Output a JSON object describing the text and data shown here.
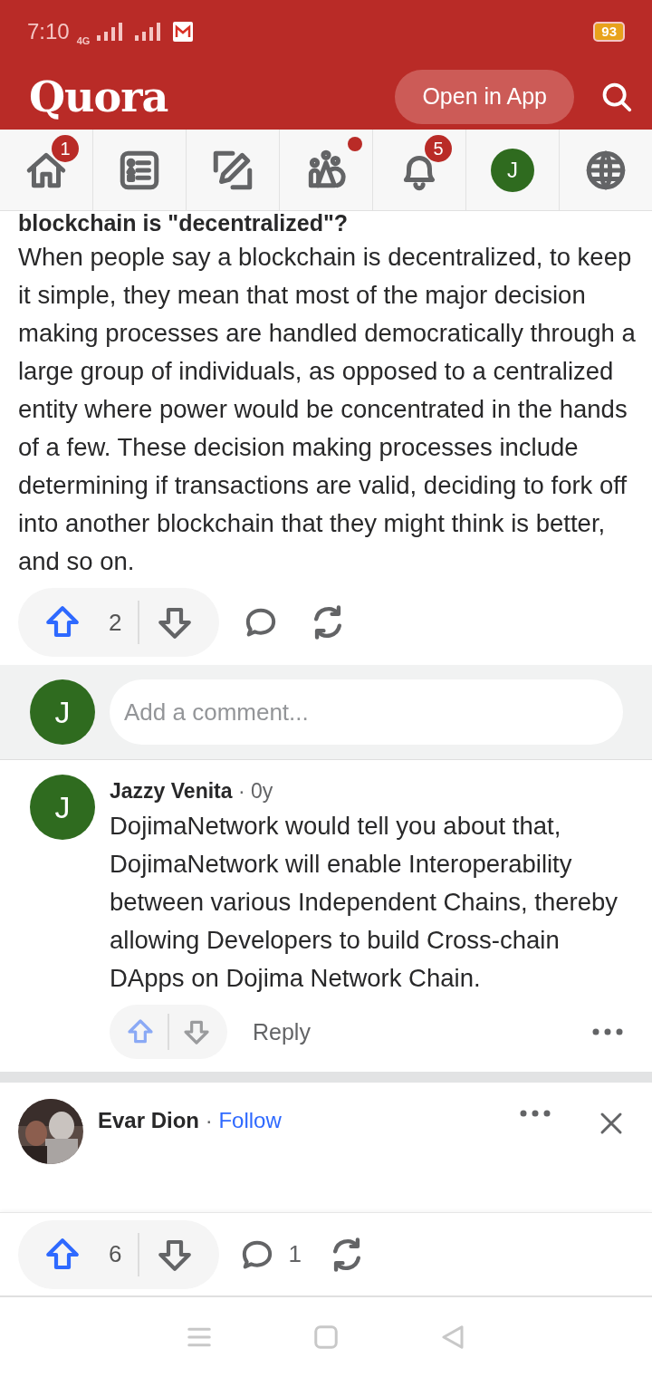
{
  "status_bar": {
    "time": "7:10",
    "network": "4G",
    "battery": "93"
  },
  "header": {
    "logo": "Quora",
    "open_app": "Open in App"
  },
  "nav": [
    {
      "kind": "home",
      "badge": "1",
      "dot": false
    },
    {
      "kind": "answer",
      "dot": false
    },
    {
      "kind": "write",
      "dot": false
    },
    {
      "kind": "spaces",
      "dot": true
    },
    {
      "kind": "notifications",
      "badge": "5",
      "dot": false
    },
    {
      "kind": "profile",
      "initial": "J",
      "dot": false
    },
    {
      "kind": "language",
      "dot": false
    }
  ],
  "answer": {
    "question": "blockchain is \"decentralized\"?",
    "text": "When people say a blockchain is decentralized, to keep it simple, they mean that most of the major decision making processes are handled democratically through a large group of individuals, as opposed to a centralized entity where power would be concentrated in the hands of a few. These decision making processes include determining if transactions are valid, deciding to fork off into another blockchain that they might think is better, and so on.",
    "upvotes": "2"
  },
  "comment_box": {
    "avatar_initial": "J",
    "placeholder": "Add a comment..."
  },
  "comments": [
    {
      "author": "Jazzy Venita",
      "age": "· 0y",
      "avatar_initial": "J",
      "text": "DojimaNetwork would tell you about that, DojimaNetwork will enable Interoperability between various Independent Chains, thereby allowing Developers to build Cross-chain DApps on Dojima Network Chain.",
      "reply": "Reply"
    }
  ],
  "next_answer": {
    "author": "Evar Dion",
    "separator": "·",
    "follow": "Follow"
  },
  "footer": {
    "upvotes": "6",
    "comments": "1"
  }
}
